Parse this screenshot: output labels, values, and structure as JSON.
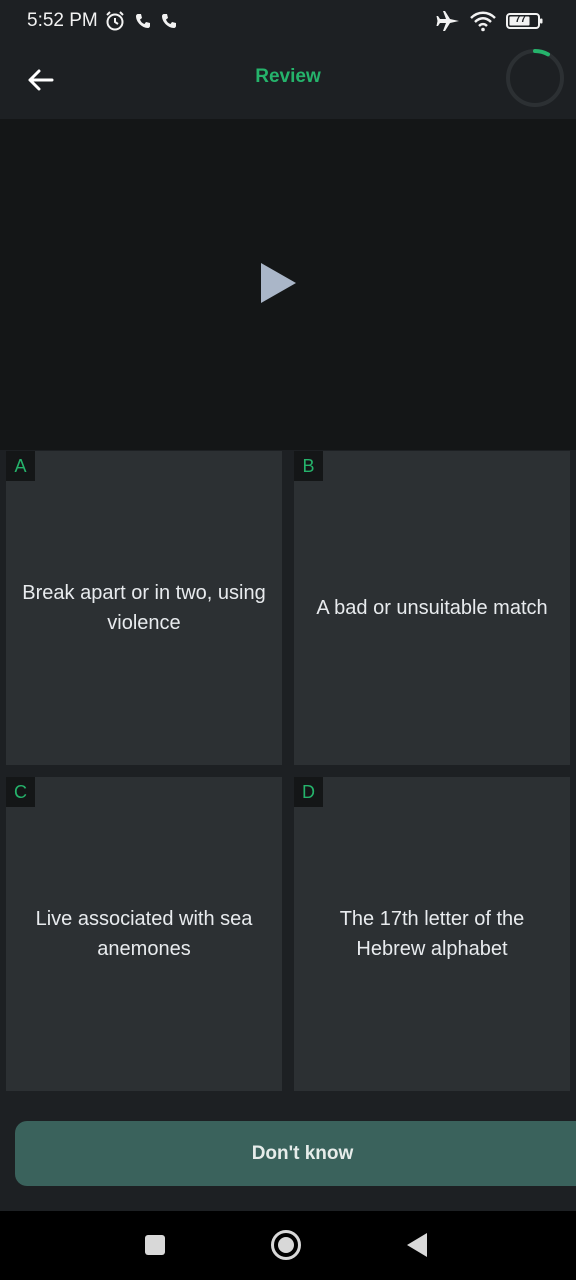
{
  "status_bar": {
    "time": "5:52 PM",
    "battery": "77"
  },
  "app_bar": {
    "title": "Review"
  },
  "options": [
    {
      "letter": "A",
      "text": "Break apart or in two, using violence"
    },
    {
      "letter": "B",
      "text": "A bad or unsuitable match"
    },
    {
      "letter": "C",
      "text": "Live associated with sea anemones"
    },
    {
      "letter": "D",
      "text": "The 17th letter of the Hebrew alphabet"
    }
  ],
  "dont_know_label": "Don't know",
  "progress": 0.08,
  "colors": {
    "accent": "#25b36b",
    "button": "#3a625c",
    "card": "#2c3033"
  },
  "icons": {
    "back": "arrow-left-icon",
    "play": "play-icon",
    "nav_recents": "square-icon",
    "nav_home": "circle-icon",
    "nav_back": "triangle-left-icon"
  }
}
